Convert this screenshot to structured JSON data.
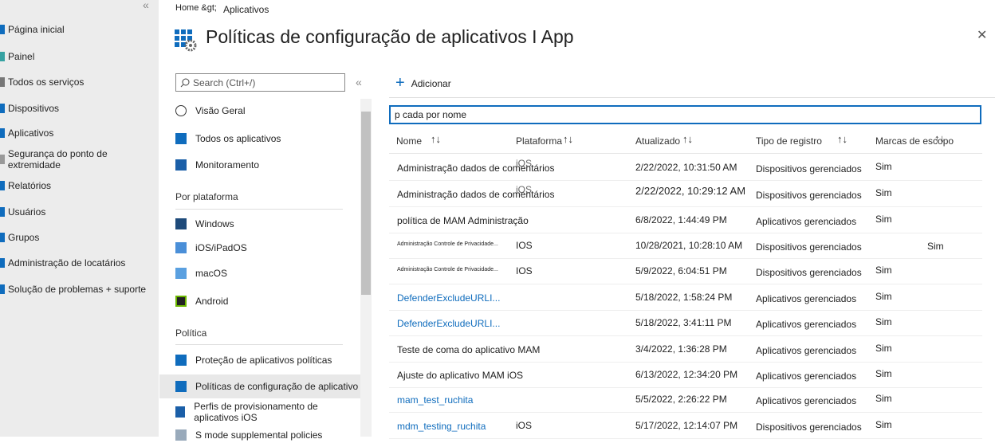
{
  "leftnav": {
    "collapse": "«",
    "items": [
      {
        "label": "Página inicial",
        "icon": "home-icon",
        "color": "#0f6cbd"
      },
      {
        "label": "Painel",
        "icon": "dashboard-icon",
        "color": "#36a2a2"
      },
      {
        "label": "Todos os serviços",
        "icon": "list-icon",
        "color": "#777"
      },
      {
        "label": "Dispositivos",
        "icon": "devices-icon",
        "color": "#0f6cbd"
      },
      {
        "label": "Aplicativos",
        "icon": "apps-icon",
        "color": "#0f6cbd"
      },
      {
        "label": "Segurança do ponto de extremidade",
        "icon": "security-icon",
        "color": "#999"
      },
      {
        "label": "Relatórios",
        "icon": "reports-icon",
        "color": "#0f6cbd"
      },
      {
        "label": "Usuários",
        "icon": "users-icon",
        "color": "#0f6cbd"
      },
      {
        "label": "Grupos",
        "icon": "groups-icon",
        "color": "#0f6cbd"
      },
      {
        "label": "Administração de locatários",
        "icon": "tenant-icon",
        "color": "#0f6cbd"
      },
      {
        "label": "Solução de problemas + suporte",
        "icon": "troubleshoot-icon",
        "color": "#0f6cbd"
      }
    ]
  },
  "header": {
    "breadcrumb_home": "Home &gt;",
    "breadcrumb_apps": "Aplicativos",
    "title": "Políticas de configuração de aplicativos I App",
    "close": "✕"
  },
  "blade": {
    "search_placeholder": "Search (Ctrl+/)",
    "collapse": "«",
    "items_top": [
      {
        "label": "Visão Geral"
      },
      {
        "label": "Todos os aplicativos"
      },
      {
        "label": "Monitoramento"
      }
    ],
    "section_platform": "Por plataforma",
    "items_platform": [
      {
        "label": "Windows"
      },
      {
        "label": "iOS/iPadOS"
      },
      {
        "label": "macOS"
      },
      {
        "label": "Android"
      }
    ],
    "section_policy": "Política",
    "items_policy": [
      {
        "label": "Proteção de aplicativos políticas"
      },
      {
        "label": "Políticas de configuração de aplicativo"
      },
      {
        "label": "Perfis de provisionamento de aplicativos iOS"
      },
      {
        "label": "S mode supplemental policies"
      }
    ]
  },
  "toolbar": {
    "add_icon": "+",
    "add": "Adicionar"
  },
  "filter": {
    "value": "p cada por nome"
  },
  "table": {
    "sort": "↑↓",
    "headers": [
      "Nome",
      "Plataforma",
      "Atualizado",
      "Tipo de registro",
      "Marcas de escopo"
    ],
    "rows": [
      {
        "name": "Administração dados de comentários",
        "platform": "iOS",
        "updated": "2/22/2022, 10:31:50 AM",
        "type": "Dispositivos gerenciados",
        "scope": "Sim"
      },
      {
        "name": "Administração dados de comentários",
        "platform": "iOS",
        "updated": "2/22/2022, 10:29:12 AM",
        "type": "Dispositivos gerenciados",
        "scope": "Sim"
      },
      {
        "name": "política de MAM Administração",
        "platform": "",
        "updated": "6/8/2022, 1:44:49 PM",
        "type": "Aplicativos gerenciados",
        "scope": "Sim"
      },
      {
        "name": "Administração Controle de Privacidade...",
        "platform": "IOS",
        "updated": "10/28/2021, 10:28:10 AM",
        "type": "Dispositivos gerenciados",
        "scope": "Sim"
      },
      {
        "name": "Administração Controle de Privacidade...",
        "platform": "IOS",
        "updated": "5/9/2022, 6:04:51 PM",
        "type": "Dispositivos gerenciados",
        "scope": "Sim"
      },
      {
        "name": "DefenderExcludeURLI...",
        "platform": "",
        "updated": "5/18/2022, 1:58:24 PM",
        "type": "Aplicativos gerenciados",
        "scope": "Sim"
      },
      {
        "name": "DefenderExcludeURLI...",
        "platform": "",
        "updated": "5/18/2022, 3:41:11 PM",
        "type": "Aplicativos gerenciados",
        "scope": "Sim"
      },
      {
        "name": "Teste de coma do aplicativo MAM",
        "platform": "",
        "updated": "3/4/2022, 1:36:28 PM",
        "type": "Aplicativos gerenciados",
        "scope": "Sim"
      },
      {
        "name": "Ajuste do aplicativo MAM iOS",
        "platform": "",
        "updated": "6/13/2022, 12:34:20 PM",
        "type": "Aplicativos gerenciados",
        "scope": "Sim"
      },
      {
        "name": "mam_test_ruchita",
        "platform": "",
        "updated": "5/5/2022, 2:26:22 PM",
        "type": "Aplicativos gerenciados",
        "scope": "Sim"
      },
      {
        "name": "mdm_testing_ruchita",
        "platform": "iOS",
        "updated": "5/17/2022, 12:14:07 PM",
        "type": "Dispositivos gerenciados",
        "scope": "Sim"
      }
    ]
  }
}
